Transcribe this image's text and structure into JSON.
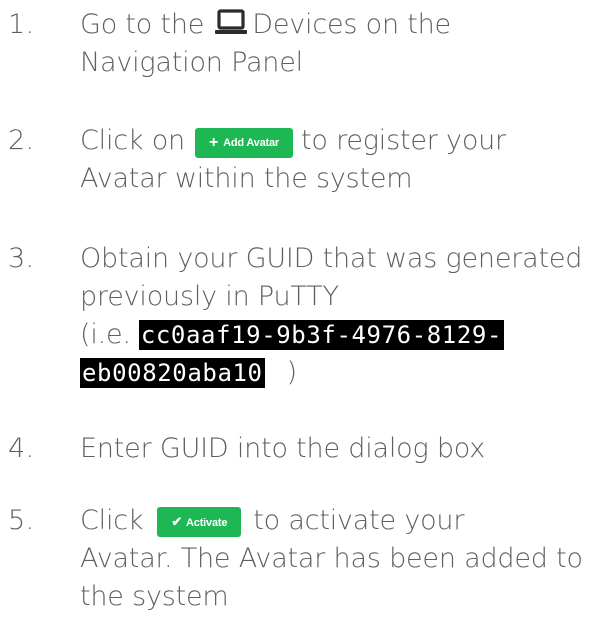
{
  "steps": [
    {
      "number": "1.",
      "text_before": "Go to the",
      "icon": "laptop-icon",
      "text_after": "Devices on the",
      "line2": "Navigation Panel"
    },
    {
      "number": "2.",
      "text_before": "Click on",
      "button_label": "Add Avatar",
      "button_icon": "plus-icon",
      "text_after": "to register your",
      "line2": "Avatar within the system"
    },
    {
      "number": "3.",
      "line1": "Obtain your GUID that was generated",
      "line2": "previously in PuTTY",
      "line3_prefix": "(i.e.",
      "guid_part1": "cc0aaf19-9b3f-4976-8129-",
      "guid_part2": "eb00820aba10",
      "line4_suffix": ")"
    },
    {
      "number": "4.",
      "text": "Enter GUID into the dialog box"
    },
    {
      "number": "5.",
      "text_before": "Click",
      "button_label": "Activate",
      "button_icon": "check-icon",
      "text_after": "to activate your",
      "line2": "Avatar. The Avatar has been added to",
      "line3": "the system"
    }
  ],
  "colors": {
    "text": "#5f5f5f",
    "button": "#1db854",
    "code_background": "#000000",
    "code_text": "#ffffff"
  }
}
